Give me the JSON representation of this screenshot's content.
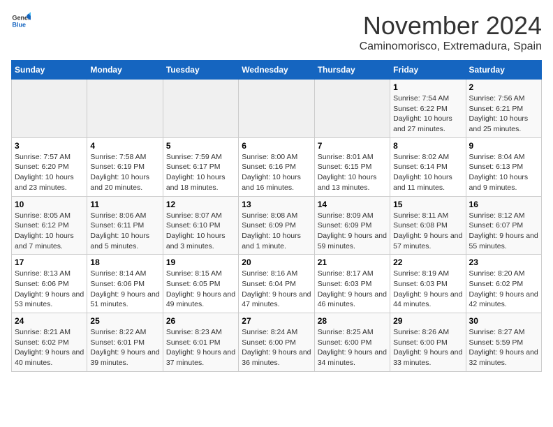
{
  "header": {
    "logo_general": "General",
    "logo_blue": "Blue",
    "month_title": "November 2024",
    "subtitle": "Caminomorisco, Extremadura, Spain"
  },
  "calendar": {
    "days_of_week": [
      "Sunday",
      "Monday",
      "Tuesday",
      "Wednesday",
      "Thursday",
      "Friday",
      "Saturday"
    ],
    "weeks": [
      [
        {
          "day": "",
          "info": ""
        },
        {
          "day": "",
          "info": ""
        },
        {
          "day": "",
          "info": ""
        },
        {
          "day": "",
          "info": ""
        },
        {
          "day": "",
          "info": ""
        },
        {
          "day": "1",
          "info": "Sunrise: 7:54 AM\nSunset: 6:22 PM\nDaylight: 10 hours and 27 minutes."
        },
        {
          "day": "2",
          "info": "Sunrise: 7:56 AM\nSunset: 6:21 PM\nDaylight: 10 hours and 25 minutes."
        }
      ],
      [
        {
          "day": "3",
          "info": "Sunrise: 7:57 AM\nSunset: 6:20 PM\nDaylight: 10 hours and 23 minutes."
        },
        {
          "day": "4",
          "info": "Sunrise: 7:58 AM\nSunset: 6:19 PM\nDaylight: 10 hours and 20 minutes."
        },
        {
          "day": "5",
          "info": "Sunrise: 7:59 AM\nSunset: 6:17 PM\nDaylight: 10 hours and 18 minutes."
        },
        {
          "day": "6",
          "info": "Sunrise: 8:00 AM\nSunset: 6:16 PM\nDaylight: 10 hours and 16 minutes."
        },
        {
          "day": "7",
          "info": "Sunrise: 8:01 AM\nSunset: 6:15 PM\nDaylight: 10 hours and 13 minutes."
        },
        {
          "day": "8",
          "info": "Sunrise: 8:02 AM\nSunset: 6:14 PM\nDaylight: 10 hours and 11 minutes."
        },
        {
          "day": "9",
          "info": "Sunrise: 8:04 AM\nSunset: 6:13 PM\nDaylight: 10 hours and 9 minutes."
        }
      ],
      [
        {
          "day": "10",
          "info": "Sunrise: 8:05 AM\nSunset: 6:12 PM\nDaylight: 10 hours and 7 minutes."
        },
        {
          "day": "11",
          "info": "Sunrise: 8:06 AM\nSunset: 6:11 PM\nDaylight: 10 hours and 5 minutes."
        },
        {
          "day": "12",
          "info": "Sunrise: 8:07 AM\nSunset: 6:10 PM\nDaylight: 10 hours and 3 minutes."
        },
        {
          "day": "13",
          "info": "Sunrise: 8:08 AM\nSunset: 6:09 PM\nDaylight: 10 hours and 1 minute."
        },
        {
          "day": "14",
          "info": "Sunrise: 8:09 AM\nSunset: 6:09 PM\nDaylight: 9 hours and 59 minutes."
        },
        {
          "day": "15",
          "info": "Sunrise: 8:11 AM\nSunset: 6:08 PM\nDaylight: 9 hours and 57 minutes."
        },
        {
          "day": "16",
          "info": "Sunrise: 8:12 AM\nSunset: 6:07 PM\nDaylight: 9 hours and 55 minutes."
        }
      ],
      [
        {
          "day": "17",
          "info": "Sunrise: 8:13 AM\nSunset: 6:06 PM\nDaylight: 9 hours and 53 minutes."
        },
        {
          "day": "18",
          "info": "Sunrise: 8:14 AM\nSunset: 6:06 PM\nDaylight: 9 hours and 51 minutes."
        },
        {
          "day": "19",
          "info": "Sunrise: 8:15 AM\nSunset: 6:05 PM\nDaylight: 9 hours and 49 minutes."
        },
        {
          "day": "20",
          "info": "Sunrise: 8:16 AM\nSunset: 6:04 PM\nDaylight: 9 hours and 47 minutes."
        },
        {
          "day": "21",
          "info": "Sunrise: 8:17 AM\nSunset: 6:03 PM\nDaylight: 9 hours and 46 minutes."
        },
        {
          "day": "22",
          "info": "Sunrise: 8:19 AM\nSunset: 6:03 PM\nDaylight: 9 hours and 44 minutes."
        },
        {
          "day": "23",
          "info": "Sunrise: 8:20 AM\nSunset: 6:02 PM\nDaylight: 9 hours and 42 minutes."
        }
      ],
      [
        {
          "day": "24",
          "info": "Sunrise: 8:21 AM\nSunset: 6:02 PM\nDaylight: 9 hours and 40 minutes."
        },
        {
          "day": "25",
          "info": "Sunrise: 8:22 AM\nSunset: 6:01 PM\nDaylight: 9 hours and 39 minutes."
        },
        {
          "day": "26",
          "info": "Sunrise: 8:23 AM\nSunset: 6:01 PM\nDaylight: 9 hours and 37 minutes."
        },
        {
          "day": "27",
          "info": "Sunrise: 8:24 AM\nSunset: 6:00 PM\nDaylight: 9 hours and 36 minutes."
        },
        {
          "day": "28",
          "info": "Sunrise: 8:25 AM\nSunset: 6:00 PM\nDaylight: 9 hours and 34 minutes."
        },
        {
          "day": "29",
          "info": "Sunrise: 8:26 AM\nSunset: 6:00 PM\nDaylight: 9 hours and 33 minutes."
        },
        {
          "day": "30",
          "info": "Sunrise: 8:27 AM\nSunset: 5:59 PM\nDaylight: 9 hours and 32 minutes."
        }
      ]
    ]
  }
}
